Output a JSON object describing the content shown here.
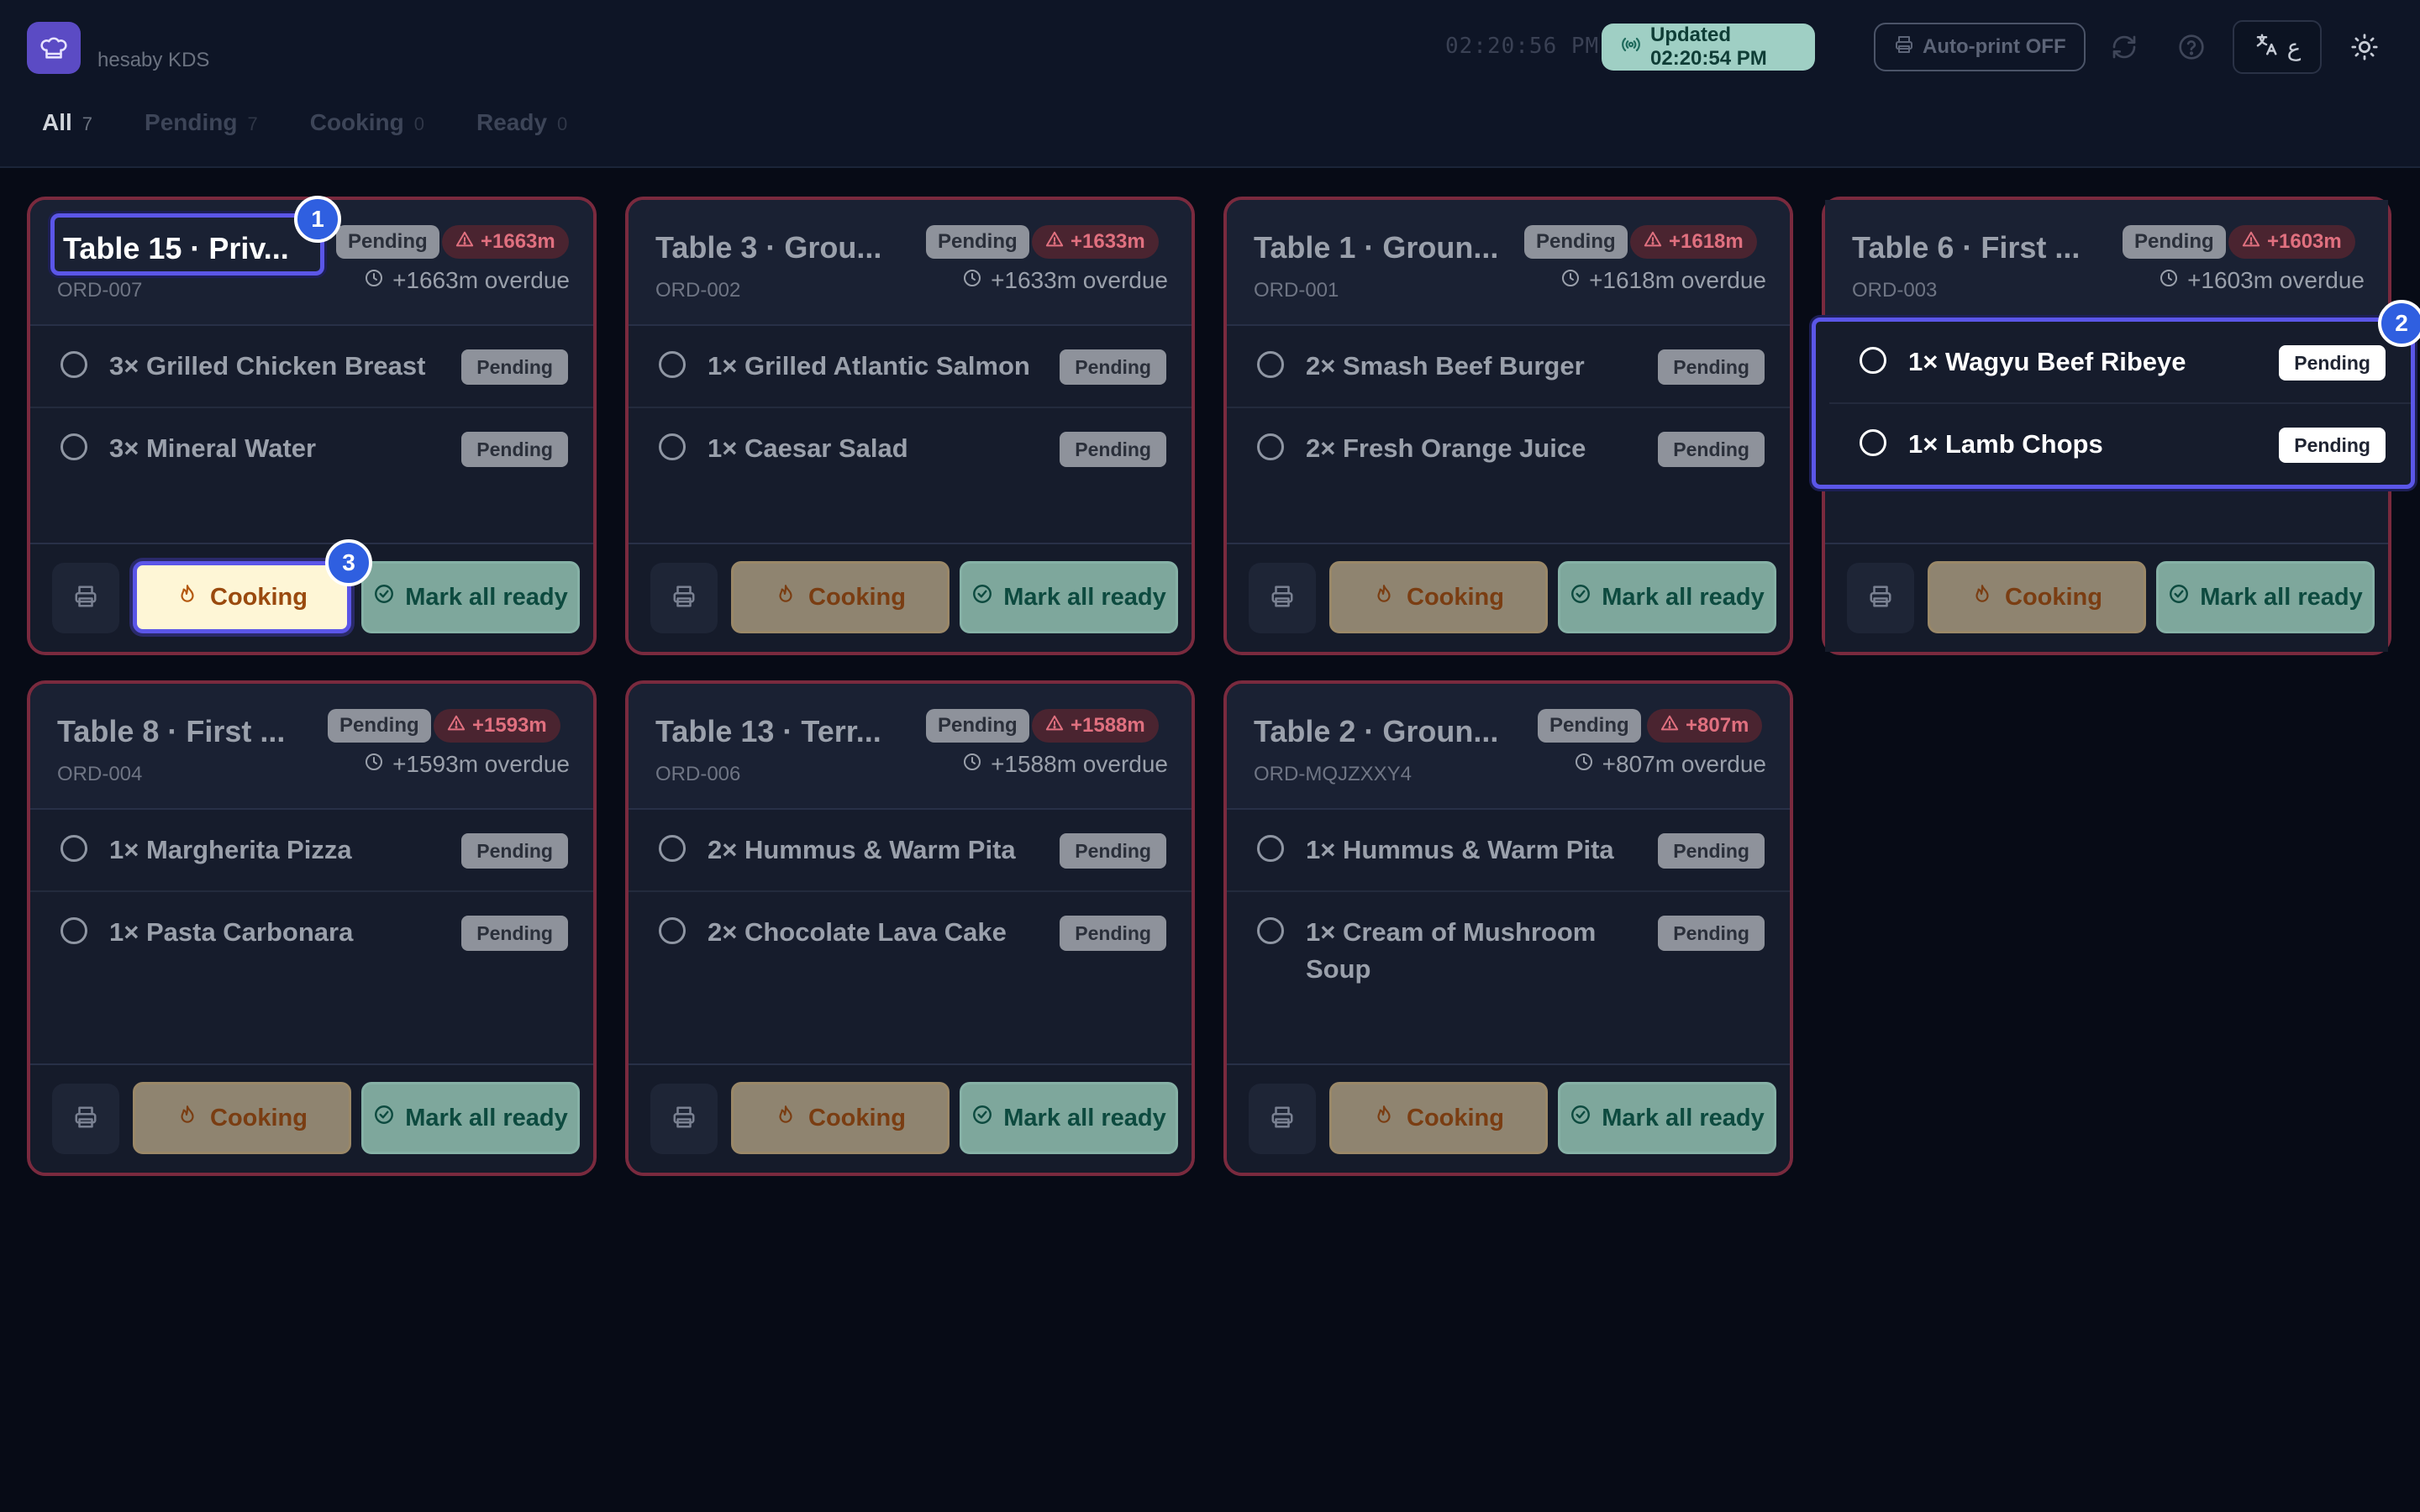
{
  "header": {
    "brand": "hesaby KDS",
    "clock": "02:20:56 PM",
    "updated": "Updated 02:20:54 PM",
    "autoprint": "Auto-print OFF",
    "lang_symbol": "ع"
  },
  "tabs": [
    {
      "label": "All",
      "count": "7"
    },
    {
      "label": "Pending",
      "count": "7"
    },
    {
      "label": "Cooking",
      "count": "0"
    },
    {
      "label": "Ready",
      "count": "0"
    }
  ],
  "buttons": {
    "cooking": "Cooking",
    "ready": "Mark all ready"
  },
  "badges": [
    "1",
    "2",
    "3"
  ],
  "cards": [
    {
      "title": "Table 15 · Priv...",
      "order": "ORD-007",
      "status": "Pending",
      "overdue_badge": "+1663m",
      "overdue_text": "+1663m overdue",
      "items": [
        {
          "name": "3× Grilled Chicken Breast",
          "status": "Pending"
        },
        {
          "name": "3× Mineral Water",
          "status": "Pending"
        }
      ]
    },
    {
      "title": "Table 3 · Grou...",
      "order": "ORD-002",
      "status": "Pending",
      "overdue_badge": "+1633m",
      "overdue_text": "+1633m overdue",
      "items": [
        {
          "name": "1× Grilled Atlantic Salmon",
          "status": "Pending"
        },
        {
          "name": "1× Caesar Salad",
          "status": "Pending"
        }
      ]
    },
    {
      "title": "Table 1 · Groun...",
      "order": "ORD-001",
      "status": "Pending",
      "overdue_badge": "+1618m",
      "overdue_text": "+1618m overdue",
      "items": [
        {
          "name": "2× Smash Beef Burger",
          "status": "Pending"
        },
        {
          "name": "2× Fresh Orange Juice",
          "status": "Pending"
        }
      ]
    },
    {
      "title": "Table 6 · First ...",
      "order": "ORD-003",
      "status": "Pending",
      "overdue_badge": "+1603m",
      "overdue_text": "+1603m overdue",
      "items": [
        {
          "name": "1× Wagyu Beef Ribeye",
          "status": "Pending"
        },
        {
          "name": "1× Lamb Chops",
          "status": "Pending"
        }
      ]
    },
    {
      "title": "Table 8 · First ...",
      "order": "ORD-004",
      "status": "Pending",
      "overdue_badge": "+1593m",
      "overdue_text": "+1593m overdue",
      "items": [
        {
          "name": "1× Margherita Pizza",
          "status": "Pending"
        },
        {
          "name": "1× Pasta Carbonara",
          "status": "Pending"
        }
      ]
    },
    {
      "title": "Table 13 · Terr...",
      "order": "ORD-006",
      "status": "Pending",
      "overdue_badge": "+1588m",
      "overdue_text": "+1588m overdue",
      "items": [
        {
          "name": "2× Hummus & Warm Pita",
          "status": "Pending"
        },
        {
          "name": "2× Chocolate Lava Cake",
          "status": "Pending"
        }
      ]
    },
    {
      "title": "Table 2 · Groun...",
      "order": "ORD-MQJZXXY4",
      "status": "Pending",
      "overdue_badge": "+807m",
      "overdue_text": "+807m overdue",
      "items": [
        {
          "name": "1× Hummus & Warm Pita",
          "status": "Pending"
        },
        {
          "name": "1× Cream of Mushroom Soup",
          "status": "Pending"
        }
      ]
    }
  ]
}
